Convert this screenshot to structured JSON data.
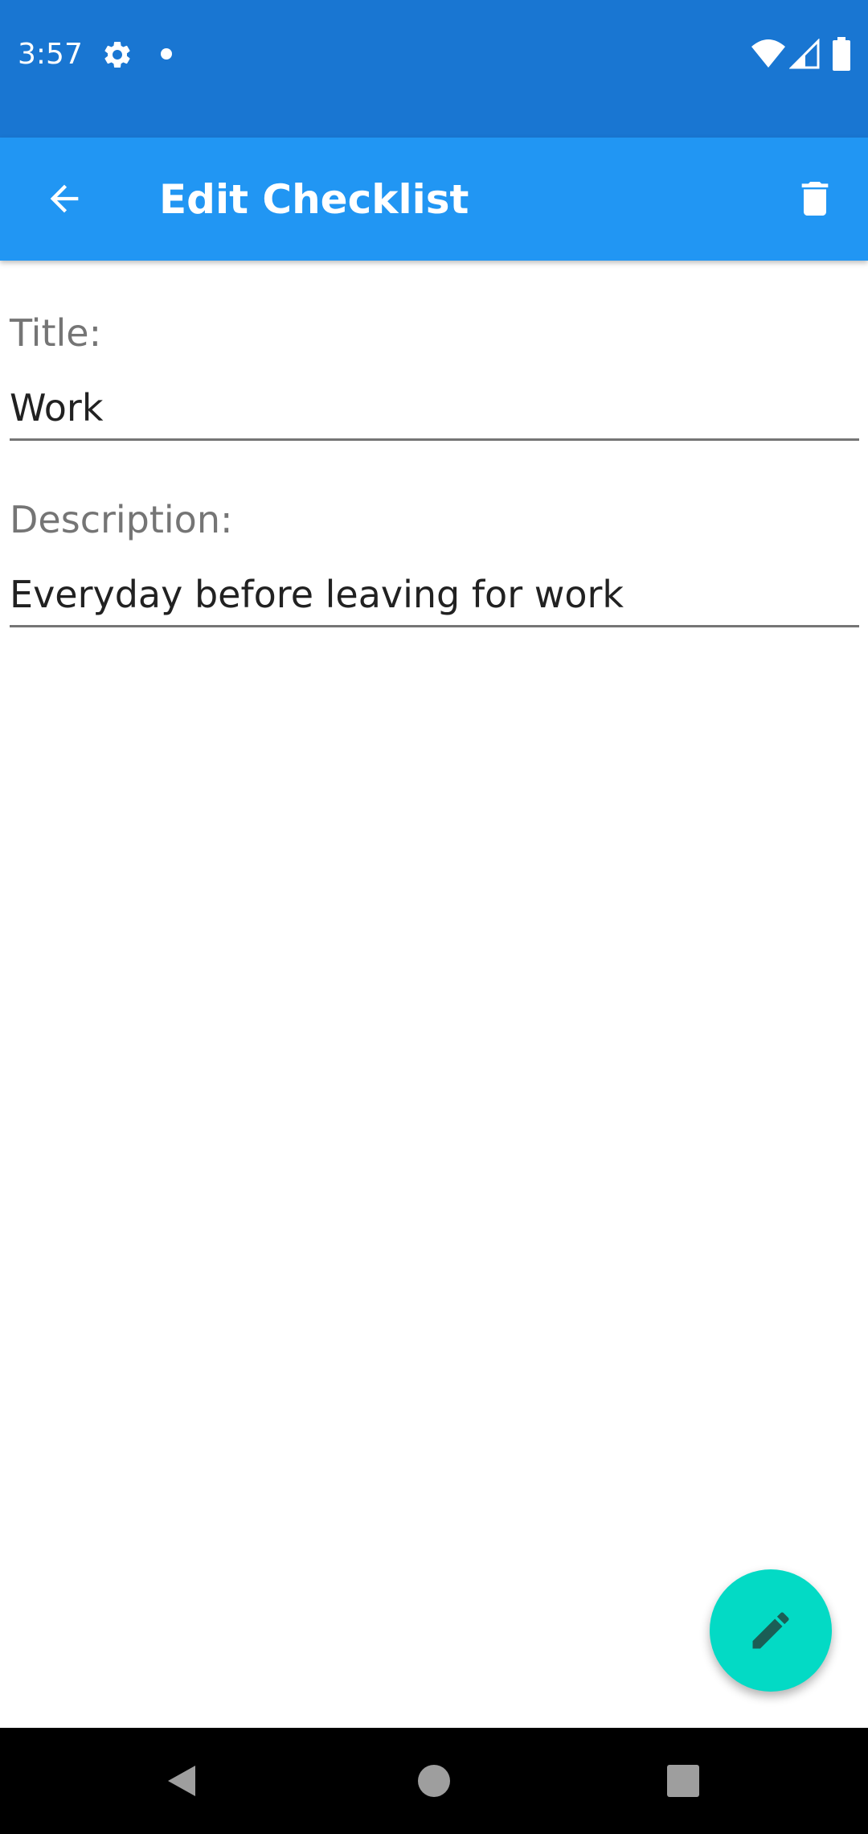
{
  "status_bar": {
    "time": "3:57",
    "icons": [
      "settings-icon",
      "notification-dot-icon",
      "wifi-icon",
      "signal-icon",
      "battery-icon"
    ],
    "color": "#1976d2"
  },
  "app_bar": {
    "title": "Edit Checklist",
    "back_icon": "arrow-back-icon",
    "delete_icon": "trash-icon",
    "color": "#2196f3"
  },
  "form": {
    "title_label": "Title:",
    "title_value": "Work",
    "description_label": "Description:",
    "description_value": "Everyday before leaving for work"
  },
  "fab": {
    "icon": "pencil-icon",
    "color": "#03dac5"
  },
  "nav_bar": {
    "buttons": [
      "back-triangle-icon",
      "home-circle-icon",
      "recents-square-icon"
    ]
  }
}
